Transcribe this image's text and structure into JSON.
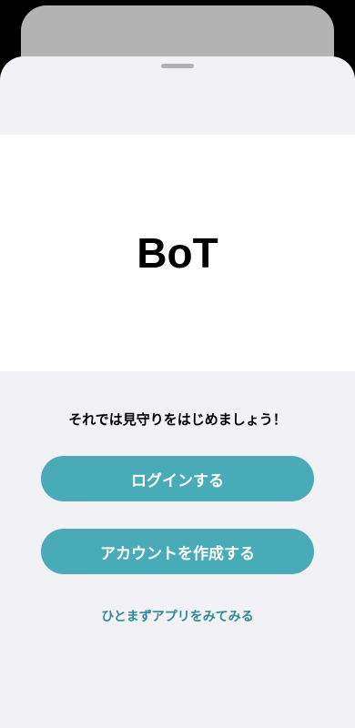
{
  "hero": {
    "logo_text": "BoT"
  },
  "onboarding": {
    "tagline": "それでは見守りをはじめましょう！",
    "login_button": "ログインする",
    "create_account_button": "アカウントを作成する",
    "try_app_link": "ひとまずアプリをみてみる"
  },
  "colors": {
    "accent": "#4aabb8",
    "link": "#2e8a9a",
    "sheet_background": "#f1f1f6",
    "hero_background": "#ffffff"
  }
}
